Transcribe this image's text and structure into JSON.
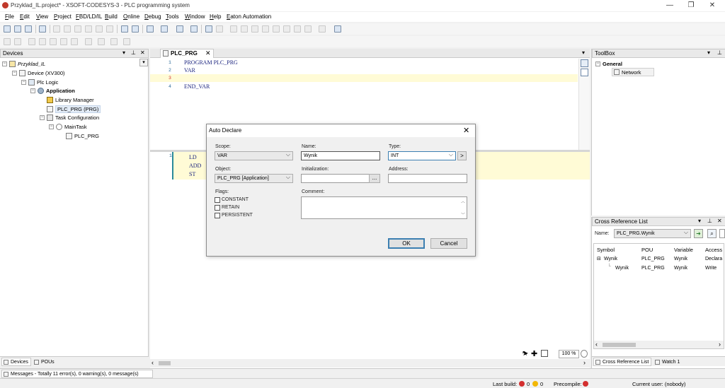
{
  "window": {
    "title": "Przyklad_IL.project* - XSOFT-CODESYS-3 - PLC programming system",
    "controls": {
      "minimize": "—",
      "maximize": "❐",
      "close": "✕"
    }
  },
  "menu": [
    "File",
    "Edit",
    "View",
    "Project",
    "FBD/LD/IL",
    "Build",
    "Online",
    "Debug",
    "Tools",
    "Window",
    "Help",
    "Eaton Automation"
  ],
  "devices_panel": {
    "title": "Devices",
    "tree": [
      {
        "label": "Przyklad_IL",
        "expander": "−",
        "icon": "project-icon"
      },
      {
        "label": "Device (XV300)",
        "expander": "−",
        "icon": "device-icon"
      },
      {
        "label": "Plc Logic",
        "expander": "−",
        "icon": "plc-logic-icon"
      },
      {
        "label": "Application",
        "expander": "−",
        "icon": "application-icon"
      },
      {
        "label": "Library Manager",
        "icon": "library-icon"
      },
      {
        "label": "PLC_PRG (PRG)",
        "icon": "program-icon"
      },
      {
        "label": "Task Configuration",
        "expander": "−",
        "icon": "task-config-icon"
      },
      {
        "label": "MainTask",
        "expander": "−",
        "icon": "task-icon"
      },
      {
        "label": "PLC_PRG",
        "icon": "program-call-icon"
      }
    ],
    "bottom_tabs": [
      "Devices",
      "POUs"
    ]
  },
  "editor": {
    "tab_label": "PLC_PRG",
    "declaration_lines": [
      {
        "no": "1",
        "text": "PROGRAM PLC_PRG"
      },
      {
        "no": "2",
        "text": "VAR"
      },
      {
        "no": "3",
        "text": ""
      },
      {
        "no": "4",
        "text": "END_VAR"
      }
    ],
    "implementation": {
      "line_no": "1",
      "instructions": [
        "LD",
        "ADD",
        "ST"
      ]
    },
    "zoom": "100 %"
  },
  "toolbox": {
    "title": "ToolBox",
    "group": "General",
    "items": [
      "Network"
    ]
  },
  "cross_reference": {
    "title": "Cross Reference List",
    "name_label": "Name:",
    "name_value": "PLC_PRG.Wynik",
    "columns": [
      "Symbol",
      "POU",
      "Variable",
      "Access"
    ],
    "rows": [
      {
        "symbol": "Wynik",
        "pou": "PLC_PRG",
        "variable": "Wynik",
        "access": "Declara"
      },
      {
        "symbol": "Wynik",
        "pou": "PLC_PRG",
        "variable": "Wynik",
        "access": "Write"
      }
    ],
    "bottom_tabs": [
      "Cross Reference List",
      "Watch 1"
    ]
  },
  "dialog": {
    "title": "Auto Declare",
    "scope_label": "Scope:",
    "scope_value": "VAR",
    "name_label": "Name:",
    "name_value": "Wynik",
    "type_label": "Type:",
    "type_value": "INT",
    "type_button": ">",
    "object_label": "Object:",
    "object_value": "PLC_PRG [Application]",
    "init_label": "Initialization:",
    "init_value": "",
    "init_button": "...",
    "address_label": "Address:",
    "address_value": "",
    "flags_label": "Flags:",
    "flags": [
      "CONSTANT",
      "RETAIN",
      "PERSISTENT"
    ],
    "comment_label": "Comment:",
    "ok": "OK",
    "cancel": "Cancel"
  },
  "messages": "Messages - Totally 11 error(s), 0 warning(s), 0 message(s)",
  "status": {
    "last_build_label": "Last build:",
    "errors": "0",
    "warnings": "0",
    "precompile_label": "Precompile:",
    "current_user": "Current user: (nobody)"
  }
}
